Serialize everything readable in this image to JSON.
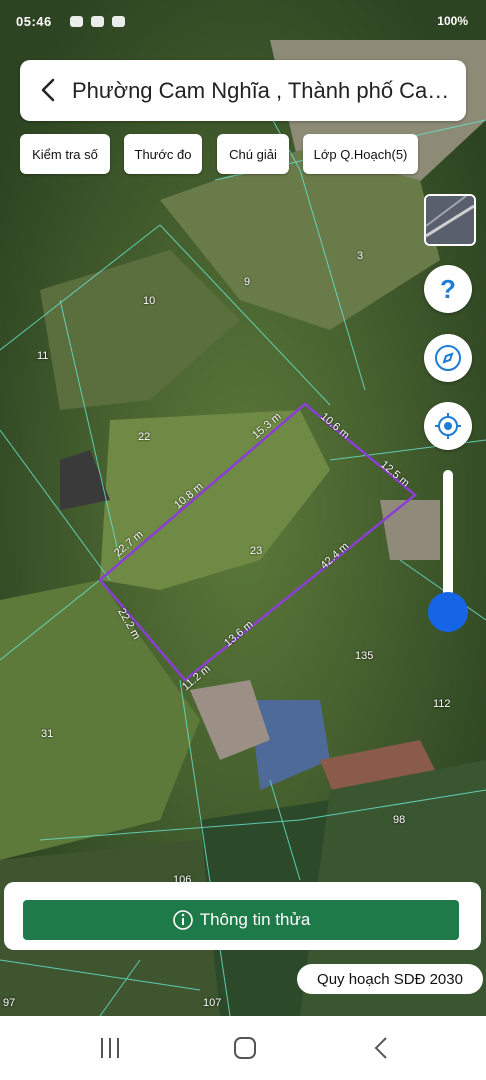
{
  "status_bar": {
    "time": "05:46",
    "right_text": "100%"
  },
  "header": {
    "title": "Phường Cam Nghĩa , Thành phố Cam Ranh",
    "back_icon": "chevron-left-icon"
  },
  "toolbar": {
    "chips": [
      {
        "label": "Kiểm tra số"
      },
      {
        "label": "Thước đo"
      },
      {
        "label": "Chú giải"
      },
      {
        "label": "Lớp Q.Hoạch(5)"
      }
    ]
  },
  "map": {
    "parcels": [
      "3",
      "9",
      "10",
      "11",
      "22",
      "23",
      "135",
      "112",
      "31",
      "98",
      "106",
      "97",
      "107"
    ],
    "measurements": [
      "15.3 m",
      "10.6 m",
      "12.5 m",
      "10.8 m",
      "22.7 m",
      "42.4 m",
      "22.2 m",
      "13.6 m",
      "11.2 m"
    ],
    "highlight_color": "#8a3fd6"
  },
  "right_controls": {
    "help_icon": "question-icon",
    "compass_icon": "compass-icon",
    "locate_icon": "crosshair-icon"
  },
  "bottom_panel": {
    "info_button": "Thông tin thửa",
    "info_icon": "info-icon"
  },
  "planning_tag": "Quy hoạch SDĐ 2030",
  "colors": {
    "accent_green": "#1f7a4a",
    "slider_blue": "#1565e6"
  }
}
